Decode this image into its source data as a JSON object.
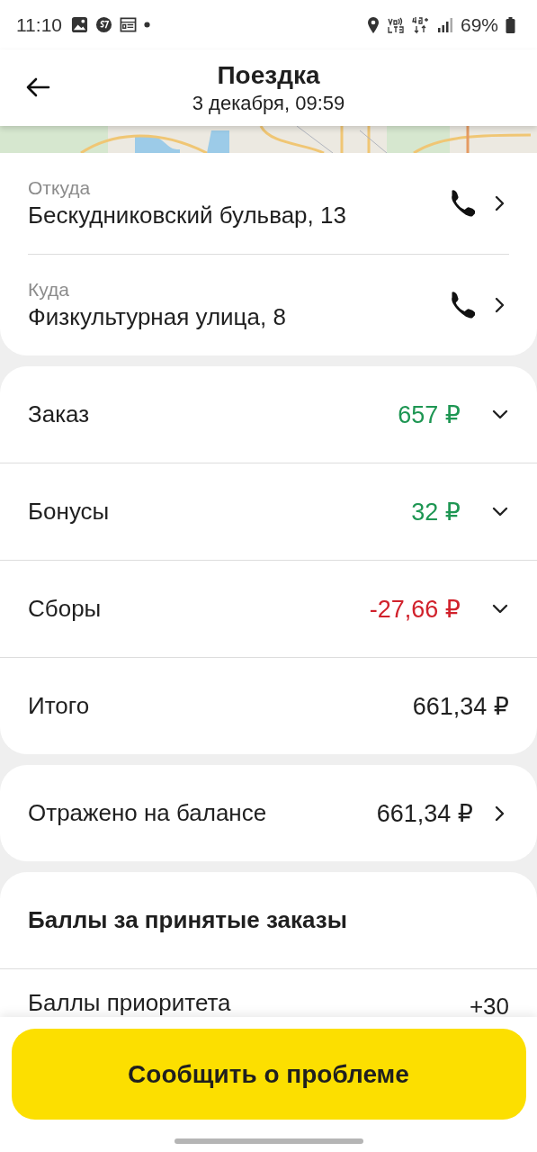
{
  "status_bar": {
    "time": "11:10",
    "battery": "69%"
  },
  "header": {
    "title": "Поездка",
    "subtitle": "3 декабря, 09:59"
  },
  "addresses": [
    {
      "label": "Откуда",
      "address": "Бескудниковский бульвар, 13"
    },
    {
      "label": "Куда",
      "address": "Физкультурная улица, 8"
    }
  ],
  "breakdown": [
    {
      "label": "Заказ",
      "value": "657 ₽",
      "color": "#1e9653",
      "expandable": true
    },
    {
      "label": "Бонусы",
      "value": "32 ₽",
      "color": "#1e9653",
      "expandable": true
    },
    {
      "label": "Сборы",
      "value": "-27,66 ₽",
      "color": "#d1222c",
      "expandable": true
    },
    {
      "label": "Итого",
      "value": "661,34 ₽",
      "color": "#1f1f1f",
      "expandable": false
    }
  ],
  "balance": {
    "label": "Отражено на балансе",
    "value": "661,34 ₽"
  },
  "points": {
    "title": "Баллы за принятые заказы",
    "rows": [
      {
        "label": "Баллы приоритета",
        "value": "+30"
      }
    ]
  },
  "action_button": "Сообщить о проблеме"
}
